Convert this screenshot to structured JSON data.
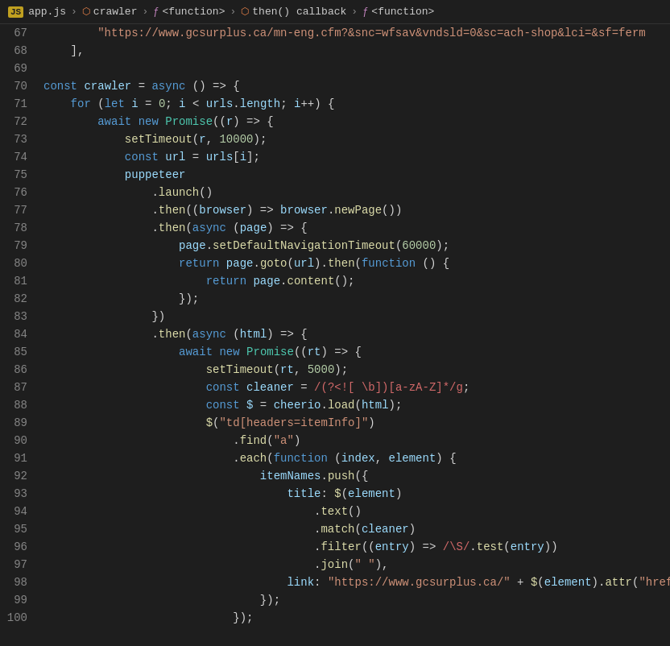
{
  "breadcrumb": {
    "items": [
      {
        "label": "app.js",
        "type": "js-file"
      },
      {
        "label": "crawler",
        "type": "object"
      },
      {
        "label": "<function>",
        "type": "function"
      },
      {
        "label": "then() callback",
        "type": "object"
      },
      {
        "label": "<function>",
        "type": "function"
      }
    ]
  },
  "lines": [
    {
      "num": 67,
      "tokens": [
        {
          "t": "str",
          "v": "        \"https://www.gcsurplus.ca/mn-eng.cfm?&snc=wfsav&vndsld=0&sc=ach-shop&lci=&sf=ferm"
        },
        {
          "t": "plain",
          "v": ""
        }
      ]
    },
    {
      "num": 68,
      "tokens": [
        {
          "t": "plain",
          "v": "    ],"
        }
      ]
    },
    {
      "num": 69,
      "tokens": []
    },
    {
      "num": 70,
      "tokens": [
        {
          "t": "kw",
          "v": "const "
        },
        {
          "t": "var",
          "v": "crawler"
        },
        {
          "t": "plain",
          "v": " = "
        },
        {
          "t": "kw",
          "v": "async"
        },
        {
          "t": "plain",
          "v": " () => {"
        }
      ]
    },
    {
      "num": 71,
      "tokens": [
        {
          "t": "plain",
          "v": "    "
        },
        {
          "t": "kw",
          "v": "for"
        },
        {
          "t": "plain",
          "v": " ("
        },
        {
          "t": "kw",
          "v": "let"
        },
        {
          "t": "var",
          "v": " i"
        },
        {
          "t": "plain",
          "v": " = "
        },
        {
          "t": "num",
          "v": "0"
        },
        {
          "t": "plain",
          "v": "; "
        },
        {
          "t": "var",
          "v": "i"
        },
        {
          "t": "plain",
          "v": " < "
        },
        {
          "t": "var",
          "v": "urls"
        },
        {
          "t": "plain",
          "v": "."
        },
        {
          "t": "prop",
          "v": "length"
        },
        {
          "t": "plain",
          "v": "; "
        },
        {
          "t": "var",
          "v": "i"
        },
        {
          "t": "plain",
          "v": "++) {"
        }
      ]
    },
    {
      "num": 72,
      "tokens": [
        {
          "t": "plain",
          "v": "        "
        },
        {
          "t": "kw",
          "v": "await"
        },
        {
          "t": "plain",
          "v": " "
        },
        {
          "t": "kw",
          "v": "new"
        },
        {
          "t": "plain",
          "v": " "
        },
        {
          "t": "type",
          "v": "Promise"
        },
        {
          "t": "plain",
          "v": "(("
        },
        {
          "t": "param",
          "v": "r"
        },
        {
          "t": "plain",
          "v": ") => {"
        }
      ]
    },
    {
      "num": 73,
      "tokens": [
        {
          "t": "plain",
          "v": "            "
        },
        {
          "t": "fn",
          "v": "setTimeout"
        },
        {
          "t": "plain",
          "v": "("
        },
        {
          "t": "var",
          "v": "r"
        },
        {
          "t": "plain",
          "v": ", "
        },
        {
          "t": "num",
          "v": "10000"
        },
        {
          "t": "plain",
          "v": ");"
        }
      ]
    },
    {
      "num": 74,
      "tokens": [
        {
          "t": "plain",
          "v": "            "
        },
        {
          "t": "kw",
          "v": "const"
        },
        {
          "t": "plain",
          "v": " "
        },
        {
          "t": "var",
          "v": "url"
        },
        {
          "t": "plain",
          "v": " = "
        },
        {
          "t": "var",
          "v": "urls"
        },
        {
          "t": "plain",
          "v": "["
        },
        {
          "t": "var",
          "v": "i"
        },
        {
          "t": "plain",
          "v": "];"
        }
      ]
    },
    {
      "num": 75,
      "tokens": [
        {
          "t": "plain",
          "v": "            "
        },
        {
          "t": "var",
          "v": "puppeteer"
        }
      ]
    },
    {
      "num": 76,
      "tokens": [
        {
          "t": "plain",
          "v": "                ."
        },
        {
          "t": "fn",
          "v": "launch"
        },
        {
          "t": "plain",
          "v": "()"
        }
      ]
    },
    {
      "num": 77,
      "tokens": [
        {
          "t": "plain",
          "v": "                ."
        },
        {
          "t": "fn",
          "v": "then"
        },
        {
          "t": "plain",
          "v": "(("
        },
        {
          "t": "param",
          "v": "browser"
        },
        {
          "t": "plain",
          "v": ") => "
        },
        {
          "t": "var",
          "v": "browser"
        },
        {
          "t": "plain",
          "v": "."
        },
        {
          "t": "fn",
          "v": "newPage"
        },
        {
          "t": "plain",
          "v": "())"
        }
      ]
    },
    {
      "num": 78,
      "tokens": [
        {
          "t": "plain",
          "v": "                ."
        },
        {
          "t": "fn",
          "v": "then"
        },
        {
          "t": "plain",
          "v": "("
        },
        {
          "t": "kw",
          "v": "async"
        },
        {
          "t": "plain",
          "v": " ("
        },
        {
          "t": "param",
          "v": "page"
        },
        {
          "t": "plain",
          "v": ") => {"
        }
      ]
    },
    {
      "num": 79,
      "tokens": [
        {
          "t": "plain",
          "v": "                    "
        },
        {
          "t": "var",
          "v": "page"
        },
        {
          "t": "plain",
          "v": "."
        },
        {
          "t": "fn",
          "v": "setDefaultNavigationTimeout"
        },
        {
          "t": "plain",
          "v": "("
        },
        {
          "t": "num",
          "v": "60000"
        },
        {
          "t": "plain",
          "v": ");"
        }
      ]
    },
    {
      "num": 80,
      "tokens": [
        {
          "t": "plain",
          "v": "                    "
        },
        {
          "t": "kw",
          "v": "return"
        },
        {
          "t": "plain",
          "v": " "
        },
        {
          "t": "var",
          "v": "page"
        },
        {
          "t": "plain",
          "v": "."
        },
        {
          "t": "fn",
          "v": "goto"
        },
        {
          "t": "plain",
          "v": "("
        },
        {
          "t": "var",
          "v": "url"
        },
        {
          "t": "plain",
          "v": ")."
        },
        {
          "t": "fn",
          "v": "then"
        },
        {
          "t": "plain",
          "v": "("
        },
        {
          "t": "kw",
          "v": "function"
        },
        {
          "t": "plain",
          "v": " () {"
        }
      ]
    },
    {
      "num": 81,
      "tokens": [
        {
          "t": "plain",
          "v": "                        "
        },
        {
          "t": "kw",
          "v": "return"
        },
        {
          "t": "plain",
          "v": " "
        },
        {
          "t": "var",
          "v": "page"
        },
        {
          "t": "plain",
          "v": "."
        },
        {
          "t": "fn",
          "v": "content"
        },
        {
          "t": "plain",
          "v": "();"
        }
      ]
    },
    {
      "num": 82,
      "tokens": [
        {
          "t": "plain",
          "v": "                    });"
        }
      ]
    },
    {
      "num": 83,
      "tokens": [
        {
          "t": "plain",
          "v": "                })"
        }
      ]
    },
    {
      "num": 84,
      "tokens": [
        {
          "t": "plain",
          "v": "                ."
        },
        {
          "t": "fn",
          "v": "then"
        },
        {
          "t": "plain",
          "v": "("
        },
        {
          "t": "kw",
          "v": "async"
        },
        {
          "t": "plain",
          "v": " ("
        },
        {
          "t": "param",
          "v": "html"
        },
        {
          "t": "plain",
          "v": ") => {"
        }
      ]
    },
    {
      "num": 85,
      "tokens": [
        {
          "t": "plain",
          "v": "                    "
        },
        {
          "t": "kw",
          "v": "await"
        },
        {
          "t": "plain",
          "v": " "
        },
        {
          "t": "kw",
          "v": "new"
        },
        {
          "t": "plain",
          "v": " "
        },
        {
          "t": "type",
          "v": "Promise"
        },
        {
          "t": "plain",
          "v": "(("
        },
        {
          "t": "param",
          "v": "rt"
        },
        {
          "t": "plain",
          "v": ") => {"
        }
      ]
    },
    {
      "num": 86,
      "tokens": [
        {
          "t": "plain",
          "v": "                        "
        },
        {
          "t": "fn",
          "v": "setTimeout"
        },
        {
          "t": "plain",
          "v": "("
        },
        {
          "t": "var",
          "v": "rt"
        },
        {
          "t": "plain",
          "v": ", "
        },
        {
          "t": "num",
          "v": "5000"
        },
        {
          "t": "plain",
          "v": ");"
        }
      ]
    },
    {
      "num": 87,
      "tokens": [
        {
          "t": "plain",
          "v": "                        "
        },
        {
          "t": "kw",
          "v": "const"
        },
        {
          "t": "plain",
          "v": " "
        },
        {
          "t": "var",
          "v": "cleaner"
        },
        {
          "t": "plain",
          "v": " = "
        },
        {
          "t": "regex",
          "v": "/(?<![ \\b])[a-zA-Z]*/g"
        },
        {
          "t": "plain",
          "v": ";"
        }
      ]
    },
    {
      "num": 88,
      "tokens": [
        {
          "t": "plain",
          "v": "                        "
        },
        {
          "t": "kw",
          "v": "const"
        },
        {
          "t": "plain",
          "v": " "
        },
        {
          "t": "var",
          "v": "$"
        },
        {
          "t": "plain",
          "v": " = "
        },
        {
          "t": "var",
          "v": "cheerio"
        },
        {
          "t": "plain",
          "v": "."
        },
        {
          "t": "fn",
          "v": "load"
        },
        {
          "t": "plain",
          "v": "("
        },
        {
          "t": "var",
          "v": "html"
        },
        {
          "t": "plain",
          "v": ");"
        }
      ]
    },
    {
      "num": 89,
      "tokens": [
        {
          "t": "plain",
          "v": "                        "
        },
        {
          "t": "fn",
          "v": "$"
        },
        {
          "t": "plain",
          "v": "("
        },
        {
          "t": "str",
          "v": "\"td[headers=itemInfo]\""
        },
        {
          "t": "plain",
          "v": ")"
        }
      ]
    },
    {
      "num": 90,
      "tokens": [
        {
          "t": "plain",
          "v": "                            ."
        },
        {
          "t": "fn",
          "v": "find"
        },
        {
          "t": "plain",
          "v": "("
        },
        {
          "t": "str",
          "v": "\"a\""
        },
        {
          "t": "plain",
          "v": ")"
        }
      ]
    },
    {
      "num": 91,
      "tokens": [
        {
          "t": "plain",
          "v": "                            ."
        },
        {
          "t": "fn",
          "v": "each"
        },
        {
          "t": "plain",
          "v": "("
        },
        {
          "t": "kw",
          "v": "function"
        },
        {
          "t": "plain",
          "v": " ("
        },
        {
          "t": "param",
          "v": "index"
        },
        {
          "t": "plain",
          "v": ", "
        },
        {
          "t": "param",
          "v": "element"
        },
        {
          "t": "plain",
          "v": ") {"
        }
      ]
    },
    {
      "num": 92,
      "tokens": [
        {
          "t": "plain",
          "v": "                                "
        },
        {
          "t": "var",
          "v": "itemNames"
        },
        {
          "t": "plain",
          "v": "."
        },
        {
          "t": "fn",
          "v": "push"
        },
        {
          "t": "plain",
          "v": "({"
        }
      ]
    },
    {
      "num": 93,
      "tokens": [
        {
          "t": "plain",
          "v": "                                    "
        },
        {
          "t": "prop",
          "v": "title"
        },
        {
          "t": "plain",
          "v": ": "
        },
        {
          "t": "fn",
          "v": "$"
        },
        {
          "t": "plain",
          "v": "("
        },
        {
          "t": "var",
          "v": "element"
        },
        {
          "t": "plain",
          "v": ")"
        }
      ]
    },
    {
      "num": 94,
      "tokens": [
        {
          "t": "plain",
          "v": "                                        ."
        },
        {
          "t": "fn",
          "v": "text"
        },
        {
          "t": "plain",
          "v": "()"
        }
      ]
    },
    {
      "num": 95,
      "tokens": [
        {
          "t": "plain",
          "v": "                                        ."
        },
        {
          "t": "fn",
          "v": "match"
        },
        {
          "t": "plain",
          "v": "("
        },
        {
          "t": "var",
          "v": "cleaner"
        },
        {
          "t": "plain",
          "v": ")"
        }
      ]
    },
    {
      "num": 96,
      "tokens": [
        {
          "t": "plain",
          "v": "                                        ."
        },
        {
          "t": "fn",
          "v": "filter"
        },
        {
          "t": "plain",
          "v": "(("
        },
        {
          "t": "param",
          "v": "entry"
        },
        {
          "t": "plain",
          "v": ") => "
        },
        {
          "t": "regex",
          "v": "/\\S/"
        },
        {
          "t": "plain",
          "v": "."
        },
        {
          "t": "fn",
          "v": "test"
        },
        {
          "t": "plain",
          "v": "("
        },
        {
          "t": "var",
          "v": "entry"
        },
        {
          "t": "plain",
          "v": "))"
        }
      ]
    },
    {
      "num": 97,
      "tokens": [
        {
          "t": "plain",
          "v": "                                        ."
        },
        {
          "t": "fn",
          "v": "join"
        },
        {
          "t": "plain",
          "v": "("
        },
        {
          "t": "str",
          "v": "\" \""
        },
        {
          "t": "plain",
          "v": "),"
        }
      ]
    },
    {
      "num": 98,
      "tokens": [
        {
          "t": "plain",
          "v": "                                    "
        },
        {
          "t": "prop",
          "v": "link"
        },
        {
          "t": "plain",
          "v": ": "
        },
        {
          "t": "str",
          "v": "\"https://www.gcsurplus.ca/\""
        },
        {
          "t": "plain",
          "v": " + "
        },
        {
          "t": "fn",
          "v": "$"
        },
        {
          "t": "plain",
          "v": "("
        },
        {
          "t": "var",
          "v": "element"
        },
        {
          "t": "plain",
          "v": ")."
        },
        {
          "t": "fn",
          "v": "attr"
        },
        {
          "t": "plain",
          "v": "("
        },
        {
          "t": "str",
          "v": "\"href\""
        },
        {
          "t": "plain",
          "v": "),"
        }
      ]
    },
    {
      "num": 99,
      "tokens": [
        {
          "t": "plain",
          "v": "                                });"
        }
      ]
    },
    {
      "num": 100,
      "tokens": [
        {
          "t": "plain",
          "v": "                            });"
        }
      ]
    }
  ]
}
